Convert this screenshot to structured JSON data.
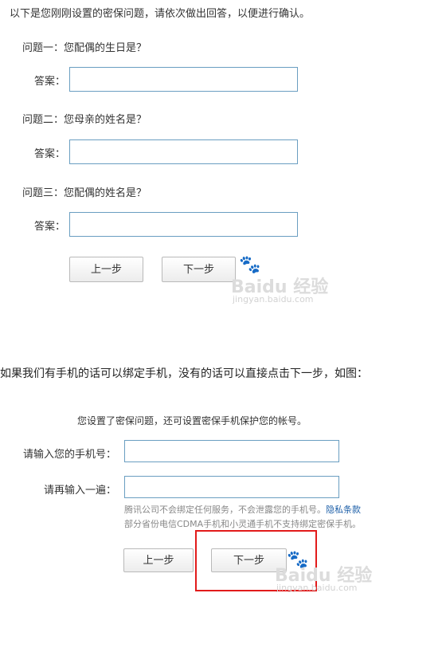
{
  "section1": {
    "intro": "以下是您刚刚设置的密保问题，请依次做出回答，以便进行确认。",
    "questions": [
      {
        "label": "问题一：您配偶的生日是？",
        "answer_label": "答案：",
        "value": ""
      },
      {
        "label": "问题二：您母亲的姓名是？",
        "answer_label": "答案：",
        "value": ""
      },
      {
        "label": "问题三：您配偶的姓名是？",
        "answer_label": "答案：",
        "value": ""
      }
    ],
    "prev_label": "上一步",
    "next_label": "下一步"
  },
  "paragraph": "如果我们有手机的话可以绑定手机，没有的话可以直接点击下一步，如图：",
  "section2": {
    "heading": "您设置了密保问题，还可设置密保手机保护您的帐号。",
    "phone_label": "请输入您的手机号：",
    "phone_value": "",
    "confirm_label": "请再输入一遍：",
    "confirm_value": "",
    "note_line1": "腾讯公司不会绑定任何服务，不会泄露您的手机号。",
    "privacy_link": "隐私条款",
    "note_line2": "部分省份电信CDMA手机和小灵通手机不支持绑定密保手机。",
    "prev_label": "上一步",
    "next_label": "下一步"
  },
  "watermark": {
    "logo": "Baidu 经验",
    "url": "jingyan.baidu.com"
  },
  "colors": {
    "input_border": "#6a9ec1",
    "highlight": "#e21b1b",
    "link": "#1d5fa8"
  }
}
